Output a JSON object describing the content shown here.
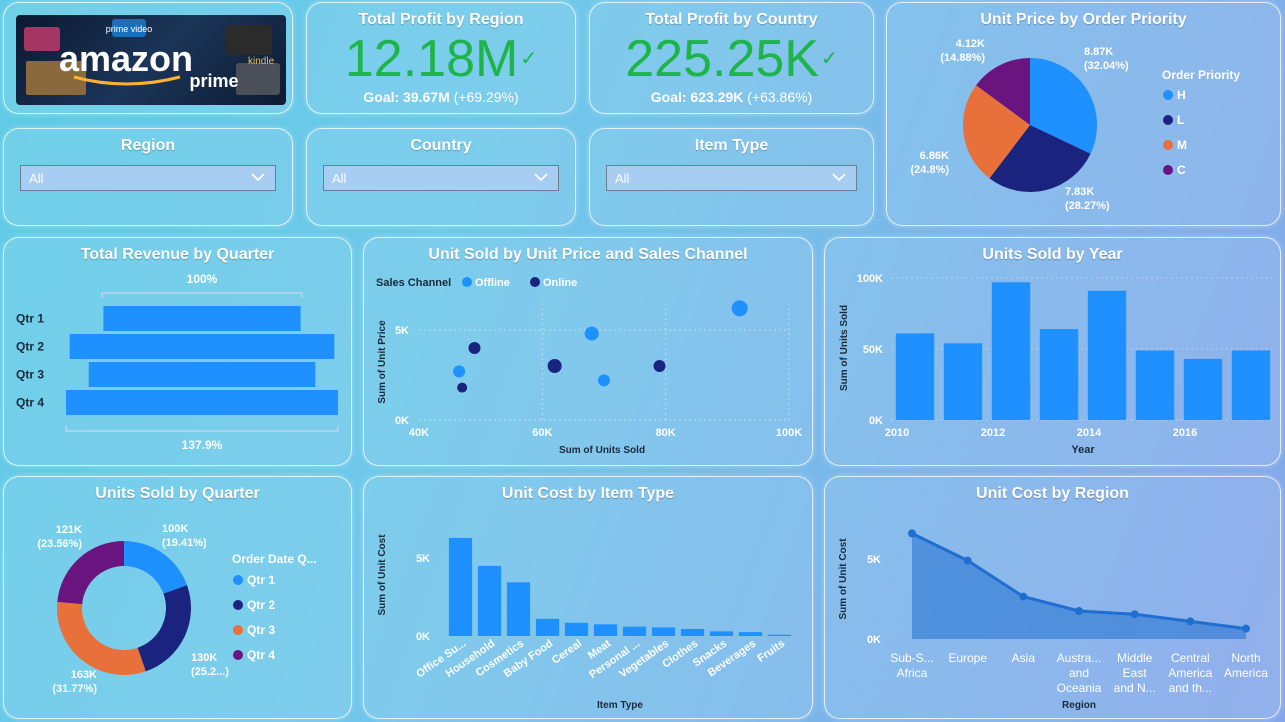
{
  "colors": {
    "primary": "#1e90ff",
    "dark": "#1a237e",
    "orange": "#e8703a",
    "purple": "#6a1480",
    "kpi_green": "#1db54a",
    "area_line": "#1f6fd0"
  },
  "logo": {
    "brand": "amazon",
    "sub": "prime",
    "badge1": "prime video",
    "badge2": "kindle"
  },
  "kpi_region": {
    "title": "Total Profit by Region",
    "value": "12.18M",
    "goal_label": "Goal: 39.67M",
    "goal_delta": "(+69.29%)"
  },
  "kpi_country": {
    "title": "Total Profit by Country",
    "value": "225.25K",
    "goal_label": "Goal: 623.29K",
    "goal_delta": "(+63.86%)"
  },
  "slicers": [
    {
      "title": "Region",
      "value": "All"
    },
    {
      "title": "Country",
      "value": "All"
    },
    {
      "title": "Item Type",
      "value": "All"
    }
  ],
  "chart_data": [
    {
      "id": "price_priority",
      "type": "pie",
      "title": "Unit Price by Order Priority",
      "legend_title": "Order Priority",
      "legend_position": "right",
      "slices": [
        {
          "name": "H",
          "value": 8.87,
          "label": "8.87K",
          "pct": "(32.04%)",
          "color": "#1e90ff"
        },
        {
          "name": "L",
          "value": 7.83,
          "label": "7.83K",
          "pct": "(28.27%)",
          "color": "#1a237e"
        },
        {
          "name": "M",
          "value": 6.86,
          "label": "6.86K",
          "pct": "(24.8%)",
          "color": "#e8703a"
        },
        {
          "name": "C",
          "value": 4.12,
          "label": "4.12K",
          "pct": "(14.88%)",
          "color": "#6a1480"
        }
      ]
    },
    {
      "id": "revenue_quarter",
      "type": "bar",
      "title": "Total Revenue by Quarter",
      "categories": [
        "Qtr 1",
        "Qtr 2",
        "Qtr 3",
        "Qtr 4"
      ],
      "values": [
        72.5,
        97.3,
        83.3,
        100
      ],
      "top_label": "100%",
      "bottom_label": "137.9%"
    },
    {
      "id": "units_price_channel",
      "type": "scatter",
      "title": "Unit Sold by Unit Price and Sales Channel",
      "legend_title": "Sales Channel",
      "legend_position": "top-left",
      "xlabel": "Sum of Units Sold",
      "ylabel": "Sum of Unit Price",
      "xlim": [
        40,
        100
      ],
      "ylim": [
        0,
        6.5
      ],
      "xticks": [
        "40K",
        "60K",
        "80K",
        "100K"
      ],
      "yticks": [
        "0K",
        "5K"
      ],
      "series": [
        {
          "name": "Offline",
          "color": "#1e90ff",
          "points": [
            [
              46.5,
              2.7
            ],
            [
              68,
              4.8
            ],
            [
              70,
              2.2
            ],
            [
              92,
              6.2
            ]
          ],
          "sizes": [
            6,
            7,
            6,
            8
          ]
        },
        {
          "name": "Online",
          "color": "#1a237e",
          "points": [
            [
              49,
              4.0
            ],
            [
              47,
              1.8
            ],
            [
              62,
              3.0
            ],
            [
              79,
              3.0
            ]
          ],
          "sizes": [
            6,
            5,
            7,
            6
          ]
        }
      ]
    },
    {
      "id": "units_year",
      "type": "bar",
      "title": "Units Sold by Year",
      "xlabel": "Year",
      "ylabel": "Sum of Units Sold",
      "categories": [
        "2010",
        "2011",
        "2012",
        "2013",
        "2014",
        "2015",
        "2016",
        "2017"
      ],
      "values": [
        61,
        54,
        97,
        64,
        91,
        49,
        43,
        49
      ],
      "xtick_labels": [
        "2010",
        "",
        "2012",
        "",
        "2014",
        "",
        "2016",
        ""
      ],
      "ylim": [
        0,
        100
      ],
      "yticks": [
        "0K",
        "50K",
        "100K"
      ]
    },
    {
      "id": "units_quarter",
      "type": "pie",
      "title": "Units Sold by Quarter",
      "legend_title": "Order Date Q...",
      "legend_position": "right",
      "slices": [
        {
          "name": "Qtr 1",
          "value": 100,
          "label": "100K",
          "pct": "(19.41%)",
          "color": "#1e90ff"
        },
        {
          "name": "Qtr 2",
          "value": 130,
          "label": "130K",
          "pct": "(25.2...)",
          "color": "#1a237e"
        },
        {
          "name": "Qtr 3",
          "value": 163,
          "label": "163K",
          "pct": "(31.77%)",
          "color": "#e8703a"
        },
        {
          "name": "Qtr 4",
          "value": 121,
          "label": "121K",
          "pct": "(23.56%)",
          "color": "#6a1480"
        }
      ]
    },
    {
      "id": "cost_item",
      "type": "bar",
      "title": "Unit Cost by Item Type",
      "xlabel": "Item Type",
      "ylabel": "Sum of Unit Cost",
      "categories": [
        "Office Su...",
        "Household",
        "Cosmetics",
        "Baby Food",
        "Cereal",
        "Meat",
        "Personal ...",
        "Vegetables",
        "Clothes",
        "Snacks",
        "Beverages",
        "Fruits"
      ],
      "values": [
        6.3,
        4.5,
        3.45,
        1.1,
        0.85,
        0.75,
        0.6,
        0.55,
        0.45,
        0.3,
        0.25,
        0.08
      ],
      "ylim": [
        0,
        7
      ],
      "yticks": [
        "0K",
        "5K"
      ]
    },
    {
      "id": "cost_region",
      "type": "area",
      "title": "Unit Cost by Region",
      "xlabel": "Region",
      "ylabel": "Sum of Unit Cost",
      "categories": [
        "Sub-S... Africa",
        "Europe",
        "Asia",
        "Austra... and Oceania",
        "Middle East and N...",
        "Central America and th...",
        "North America"
      ],
      "tick_lines": [
        [
          "Sub-S...",
          "Africa"
        ],
        [
          "Europe"
        ],
        [
          "Asia"
        ],
        [
          "Austra...",
          "and",
          "Oceania"
        ],
        [
          "Middle",
          "East",
          "and N..."
        ],
        [
          "Central",
          "America",
          "and th..."
        ],
        [
          "North",
          "America"
        ]
      ],
      "values": [
        6.6,
        4.9,
        2.65,
        1.75,
        1.55,
        1.1,
        0.65
      ],
      "ylim": [
        0,
        7
      ],
      "yticks": [
        "0K",
        "5K"
      ]
    }
  ]
}
